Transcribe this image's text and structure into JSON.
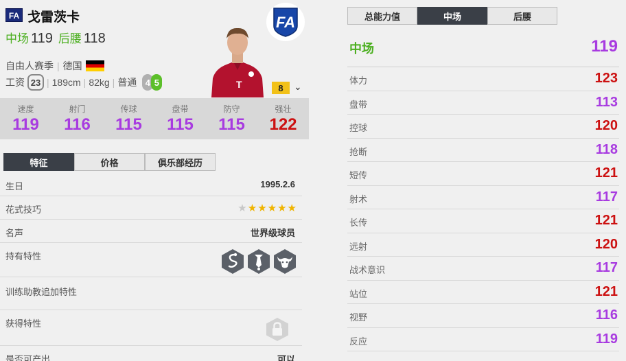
{
  "player": {
    "badge": "FA",
    "name": "戈雷茨卡",
    "pos1_label": "中场",
    "pos1_value": "119",
    "pos2_label": "后腰",
    "pos2_value": "118",
    "season": "自由人赛季",
    "nation": "德国",
    "wage_label": "工资",
    "wage": "23",
    "height": "189cm",
    "weight": "82kg",
    "body": "普通",
    "weak_foot": "4",
    "strong_foot": "5",
    "level": "8",
    "club_logo_text": "FA"
  },
  "stats": [
    {
      "label": "速度",
      "value": "119",
      "color": "#a83be0"
    },
    {
      "label": "射门",
      "value": "116",
      "color": "#a83be0"
    },
    {
      "label": "传球",
      "value": "115",
      "color": "#a83be0"
    },
    {
      "label": "盘带",
      "value": "115",
      "color": "#a83be0"
    },
    {
      "label": "防守",
      "value": "115",
      "color": "#a83be0"
    },
    {
      "label": "强壮",
      "value": "122",
      "color": "#cc1111"
    }
  ],
  "left_tabs": [
    "特征",
    "价格",
    "俱乐部经历"
  ],
  "details": {
    "birthday_label": "生日",
    "birthday": "1995.2.6",
    "skill_label": "花式技巧",
    "skill_stars": 5,
    "fame_label": "名声",
    "fame": "世界级球员",
    "traits_label": "持有特性",
    "trait_icons": [
      "snake-trait-icon",
      "tie-trait-icon",
      "bull-trait-icon"
    ],
    "coach_label": "训练助教追加特性",
    "obtain_label": "获得特性",
    "produce_label": "是否可产出",
    "produce": "可以"
  },
  "right_tabs": [
    "总能力值",
    "中场",
    "后腰"
  ],
  "position_head": {
    "label": "中场",
    "value": "119"
  },
  "attributes": [
    {
      "label": "体力",
      "value": "123",
      "color": "#cc1111"
    },
    {
      "label": "盘带",
      "value": "113",
      "color": "#a83be0"
    },
    {
      "label": "控球",
      "value": "120",
      "color": "#cc1111"
    },
    {
      "label": "抢断",
      "value": "118",
      "color": "#a83be0"
    },
    {
      "label": "短传",
      "value": "121",
      "color": "#cc1111"
    },
    {
      "label": "射术",
      "value": "117",
      "color": "#a83be0"
    },
    {
      "label": "长传",
      "value": "121",
      "color": "#cc1111"
    },
    {
      "label": "远射",
      "value": "120",
      "color": "#cc1111"
    },
    {
      "label": "战术意识",
      "value": "117",
      "color": "#a83be0"
    },
    {
      "label": "站位",
      "value": "121",
      "color": "#cc1111"
    },
    {
      "label": "视野",
      "value": "116",
      "color": "#a83be0"
    },
    {
      "label": "反应",
      "value": "119",
      "color": "#a83be0"
    }
  ]
}
